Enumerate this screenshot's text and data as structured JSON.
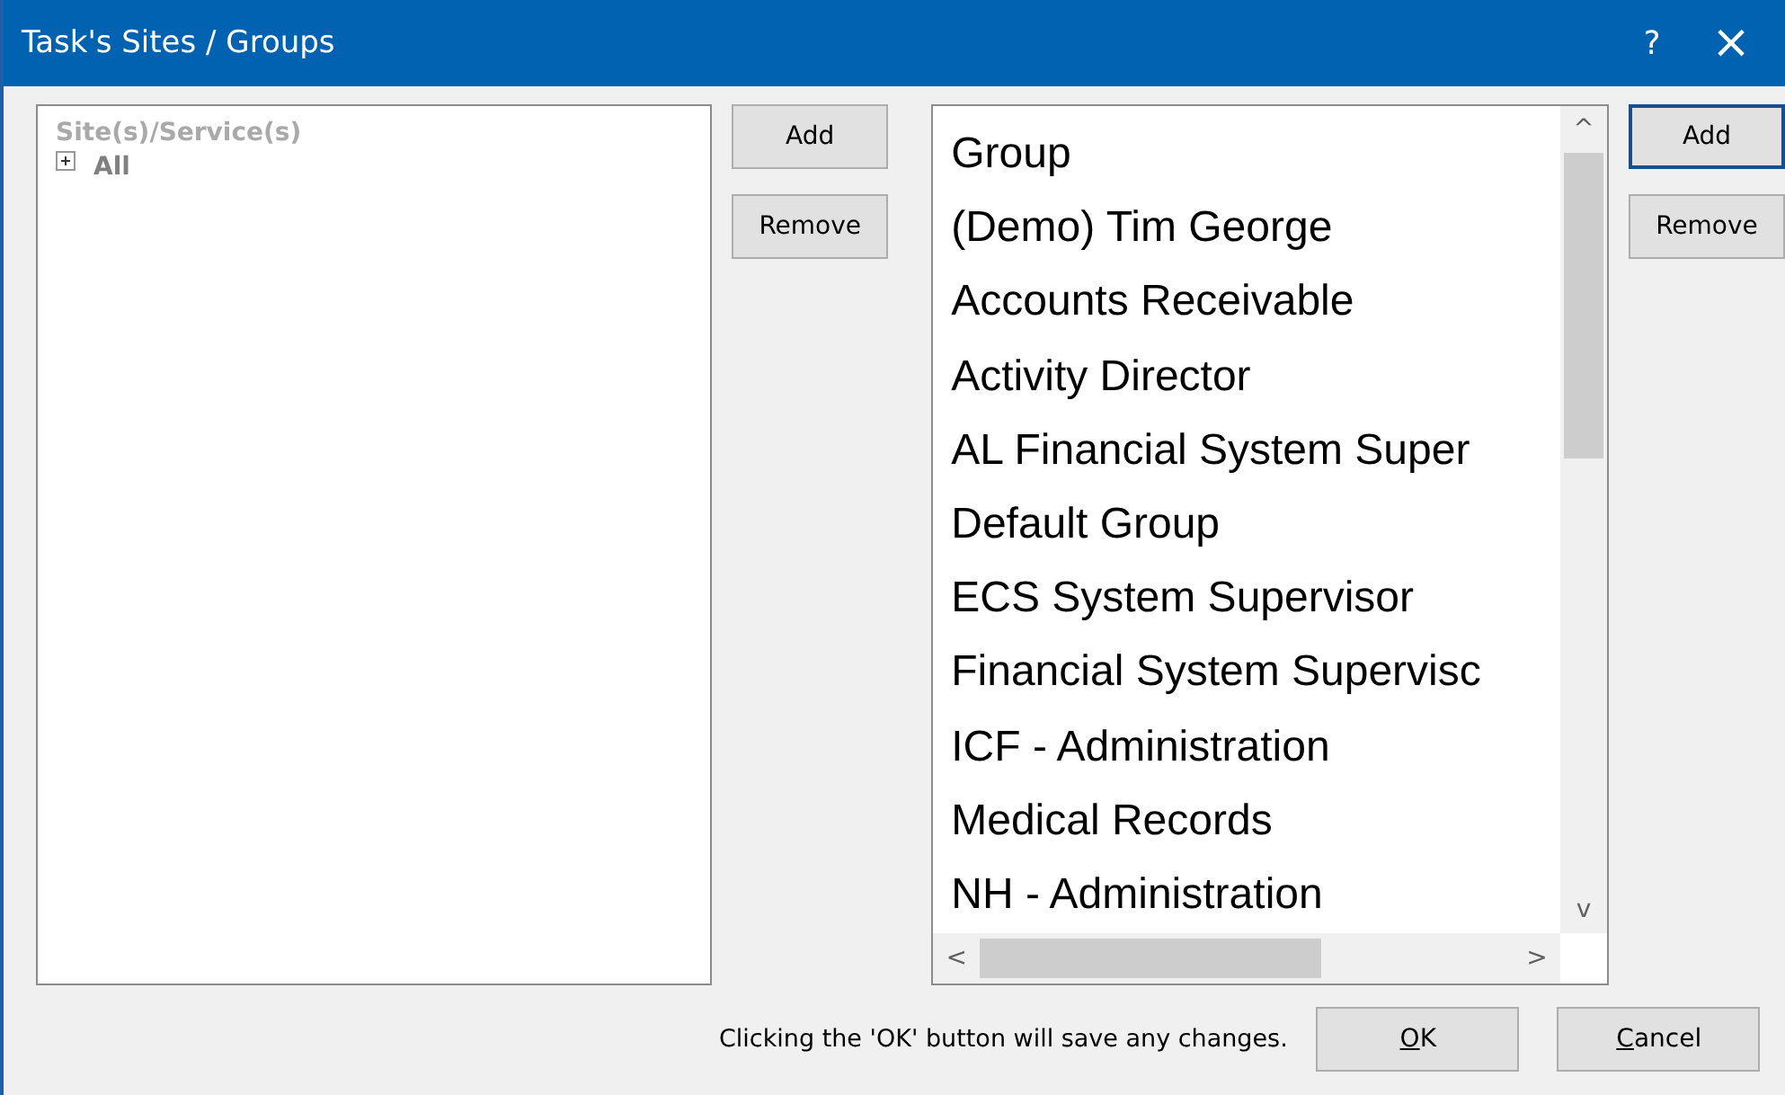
{
  "window": {
    "title": "Task's Sites / Groups",
    "help": "?",
    "close": "×"
  },
  "sites_panel": {
    "header": "Site(s)/Service(s)",
    "tree": [
      {
        "label": "All",
        "expanded": false
      }
    ]
  },
  "sites_buttons": [
    {
      "label": "Add",
      "focused": false
    },
    {
      "label": "Remove",
      "focused": false
    }
  ],
  "groups_list": {
    "items": [
      "Group",
      "(Demo) Tim George",
      "Accounts Receivable",
      "Activity Director",
      "AL Financial System Super",
      "Default Group",
      "ECS System Supervisor",
      "Financial System Supervisc",
      "ICF - Administration",
      "Medical Records",
      "NH - Administration"
    ],
    "scroll_up": "^",
    "scroll_down": "v",
    "scroll_left": "<",
    "scroll_right": ">"
  },
  "groups_buttons": [
    {
      "label": "Add",
      "focused": true
    },
    {
      "label": "Remove",
      "focused": false
    }
  ],
  "footer": {
    "note": "Clicking the 'OK' button will save any changes.",
    "buttons": [
      {
        "label": "OK"
      },
      {
        "label": "Cancel"
      }
    ]
  }
}
